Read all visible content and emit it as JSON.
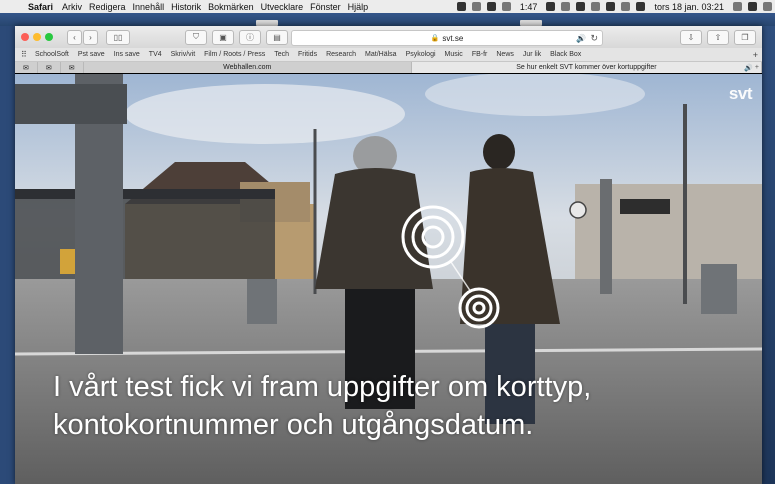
{
  "menubar": {
    "apple": "",
    "items": [
      "Safari",
      "Arkiv",
      "Redigera",
      "Innehåll",
      "Historik",
      "Bokmärken",
      "Utvecklare",
      "Fönster",
      "Hjälp"
    ],
    "time_small": "1:47",
    "clock": "tors 18 jan.  03:21"
  },
  "toolbar": {
    "url": "svt.se",
    "lock": "🔒",
    "audio": "🔊",
    "reload": "↻"
  },
  "bookmarks": [
    "SchoolSoft",
    "Pst save",
    "Ins save",
    "TV4",
    "Skriv/vit",
    "Film / Roots / Press",
    "Tech",
    "Fritids",
    "Research",
    "Mat/Hälsa",
    "Psykologi",
    "Music",
    "FB-fr",
    "News",
    "Jur lik",
    "Black Box"
  ],
  "tabs": [
    {
      "title": "",
      "kind": "small"
    },
    {
      "title": "",
      "kind": "small"
    },
    {
      "title": "",
      "kind": "small"
    },
    {
      "title": "Webhallen.com",
      "kind": "normal"
    },
    {
      "title": "Se hur enkelt SVT kommer över kortuppgifter",
      "kind": "active"
    }
  ],
  "video": {
    "logo": "svt",
    "subtitle_line1": "I vårt test fick vi fram uppgifter om korttyp,",
    "subtitle_line2": "kontokortnummer och utgångsdatum."
  },
  "colors": {
    "desktop": "#2c4a78",
    "accent": "#1e6fd9",
    "close": "#fc5f57",
    "minimize": "#fdbc2e",
    "zoom": "#28c840"
  }
}
